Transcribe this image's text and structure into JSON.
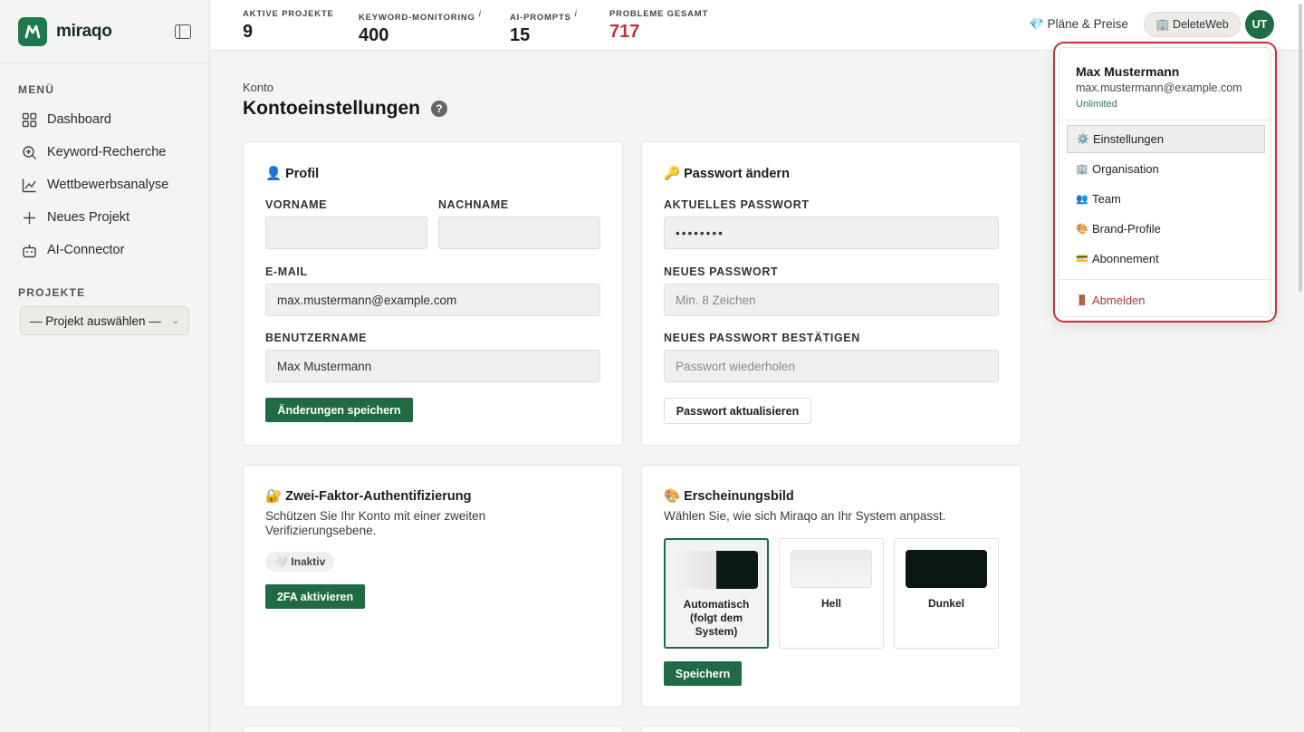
{
  "brand": {
    "name": "miraqo"
  },
  "sidebar": {
    "menu_label": "MENÜ",
    "items": [
      {
        "label": "Dashboard",
        "icon": "grid-icon"
      },
      {
        "label": "Keyword-Recherche",
        "icon": "search-plus-icon"
      },
      {
        "label": "Wettbewerbsanalyse",
        "icon": "chart-line-icon"
      },
      {
        "label": "Neues Projekt",
        "icon": "plus-icon"
      },
      {
        "label": "AI-Connector",
        "icon": "robot-icon"
      }
    ],
    "projects_label": "PROJEKTE",
    "project_select": "— Projekt auswählen —"
  },
  "topbar": {
    "stats": [
      {
        "label": "AKTIVE PROJEKTE",
        "value": "9",
        "info": ""
      },
      {
        "label": "KEYWORD-MONITORING",
        "value": "400",
        "info": "i"
      },
      {
        "label": "AI-PROMPTS",
        "value": "15",
        "info": "i"
      },
      {
        "label": "PROBLEME GESAMT",
        "value": "717",
        "info": ""
      }
    ],
    "plans": "💎 Pläne & Preise",
    "org": "🏢 DeleteWeb",
    "avatar": "UT"
  },
  "page": {
    "breadcrumb": "Konto",
    "title": "Kontoeinstellungen",
    "help": "?"
  },
  "profile": {
    "title": "👤 Profil",
    "firstname_label": "VORNAME",
    "firstname_value": "",
    "lastname_label": "NACHNAME",
    "lastname_value": "",
    "email_label": "E-MAIL",
    "email_value": "max.mustermann@example.com",
    "username_label": "BENUTZERNAME",
    "username_value": "Max Mustermann",
    "save": "Änderungen speichern"
  },
  "password": {
    "title": "🔑 Passwort ändern",
    "current_label": "AKTUELLES PASSWORT",
    "current_value": "••••••••",
    "new_label": "NEUES PASSWORT",
    "new_placeholder": "Min. 8 Zeichen",
    "confirm_label": "NEUES PASSWORT BESTÄTIGEN",
    "confirm_placeholder": "Passwort wiederholen",
    "update": "Passwort aktualisieren"
  },
  "twofa": {
    "title": "🔐 Zwei-Faktor-Authentifizierung",
    "description": "Schützen Sie Ihr Konto mit einer zweiten Verifizierungsebene.",
    "status": "🤍 Inaktiv",
    "activate": "2FA aktivieren"
  },
  "appearance": {
    "title": "🎨 Erscheinungsbild",
    "description": "Wählen Sie, wie sich Miraqo an Ihr System anpasst.",
    "options": [
      {
        "label": "Automatisch (folgt dem System)",
        "selected": true
      },
      {
        "label": "Hell",
        "selected": false
      },
      {
        "label": "Dunkel",
        "selected": false
      }
    ],
    "save": "Speichern"
  },
  "user_menu": {
    "name": "Max Mustermann",
    "email": "max.mustermann@example.com",
    "plan": "Unlimited",
    "items": [
      {
        "icon": "⚙️",
        "label": "Einstellungen"
      },
      {
        "icon": "🏢",
        "label": "Organisation"
      },
      {
        "icon": "👥",
        "label": "Team"
      },
      {
        "icon": "🎨",
        "label": "Brand-Profile"
      },
      {
        "icon": "💳",
        "label": "Abonnement"
      }
    ],
    "logout": {
      "icon": "🚪",
      "label": "Abmelden"
    }
  },
  "colors": {
    "accent": "#1e6b45",
    "danger": "#b5373d",
    "highlight_border": "#c8323a"
  }
}
